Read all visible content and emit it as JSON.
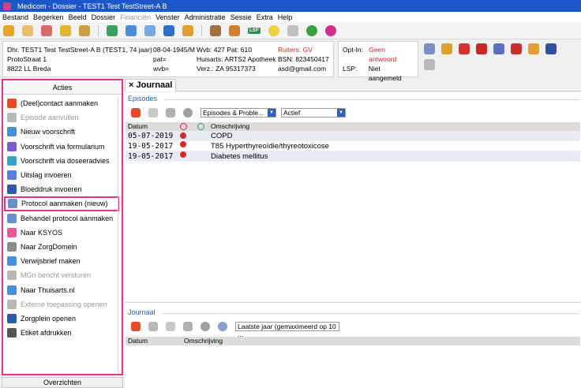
{
  "window": {
    "title": "Medicom - Dossier - TEST1 Test TestStreet-A B"
  },
  "menu": [
    {
      "label": "Bestand",
      "disabled": false
    },
    {
      "label": "Begerken",
      "disabled": false
    },
    {
      "label": "Beeld",
      "disabled": false
    },
    {
      "label": "Dossier",
      "disabled": false
    },
    {
      "label": "Financiën",
      "disabled": true
    },
    {
      "label": "Venster",
      "disabled": false
    },
    {
      "label": "Administratie",
      "disabled": false
    },
    {
      "label": "Sessie",
      "disabled": false
    },
    {
      "label": "Extra",
      "disabled": false
    },
    {
      "label": "Help",
      "disabled": false
    }
  ],
  "toolbar": {
    "lsp_label": "LSP"
  },
  "patient": {
    "name_line": "Dhr. TEST1 Test TestStreet-A B (TEST1, 74 jaar)",
    "address1": "ProtoStraat 1",
    "address2": "8822 LL Breda",
    "dob": "08-04-1945/M",
    "pat": "pat=",
    "wvb": "wvb=",
    "wwb": "Wvb: 427 Pat: 610",
    "huisarts": "Huisarts: ARTS2 Apotheek",
    "verz": "Verz.: ZA 95317373",
    "ruiters": "Ruiters: GV",
    "bsn": "BSN: 823450417",
    "email": "asd@gmail.com"
  },
  "optin": {
    "optin_label": "Opt-In:",
    "optin_value": "Geen antwoord",
    "lsp_label": "LSP:",
    "lsp_value": "Niet aangemeld"
  },
  "acties": {
    "title": "Acties",
    "items": [
      {
        "label": "(Deel)contact aanmaken",
        "disabled": false,
        "color": "#e84a2a"
      },
      {
        "label": "Episode aanvullen",
        "disabled": true,
        "color": "#b8b8b8"
      },
      {
        "label": "Nieuw voorschrift",
        "disabled": false,
        "color": "#4a8fd6"
      },
      {
        "label": "Voorschrift via formularium",
        "disabled": false,
        "color": "#7a5cc2"
      },
      {
        "label": "Voorschrift via doseeradvies",
        "disabled": false,
        "color": "#3aa0c8"
      },
      {
        "label": "Uitslag invoeren",
        "disabled": false,
        "color": "#5a7fd6"
      },
      {
        "label": "Bloeddruk invoeren",
        "disabled": false,
        "color": "#2e5aa8"
      },
      {
        "label": "Protocol aanmaken (nieuw)",
        "disabled": false,
        "color": "#6a8fc8",
        "highlight": true
      },
      {
        "label": "Behandel protocol aanmaken",
        "disabled": false,
        "color": "#6a8fc8"
      },
      {
        "label": "Naar KSYOS",
        "disabled": false,
        "color": "#e85a9a"
      },
      {
        "label": "Naar ZorgDomein",
        "disabled": false,
        "color": "#8c8c8c"
      },
      {
        "label": "Verwijsbrief maken",
        "disabled": false,
        "color": "#4a8fd6"
      },
      {
        "label": "MGn bericht versturen",
        "disabled": true,
        "color": "#b8b8b8"
      },
      {
        "label": "Naar Thuisarts.nl",
        "disabled": false,
        "color": "#4a8fd6"
      },
      {
        "label": "Externe toepassing openen",
        "disabled": true,
        "color": "#b8b8b8"
      },
      {
        "label": "Zorgplein openen",
        "disabled": false,
        "color": "#2e5aa8"
      },
      {
        "label": "Etiket afdrukken",
        "disabled": false,
        "color": "#555555"
      }
    ],
    "footer": "Overzichten"
  },
  "journaal_tab": {
    "label": "Journaal",
    "close": "×"
  },
  "episodes": {
    "section_label": "Episodes",
    "filter_1": "Episodes & Proble...",
    "filter_2": "Actief",
    "columns": {
      "datum": "Datum",
      "omschrijving": "Omschrijving"
    },
    "rows": [
      {
        "date": "05-07-2019",
        "code": "",
        "desc": "COPD"
      },
      {
        "date": "19-05-2017",
        "code": "",
        "desc": "T85 Hyperthyreoïdie/thyreotoxicose"
      },
      {
        "date": "19-05-2017",
        "code": "",
        "desc": "Diabetes mellitus"
      }
    ]
  },
  "journaal": {
    "section_label": "Journaal",
    "filter": "Laatste jaar (gemaximeerd op 10 ...",
    "columns": {
      "datum": "Datum",
      "omschrijving": "Omschrijving"
    }
  }
}
